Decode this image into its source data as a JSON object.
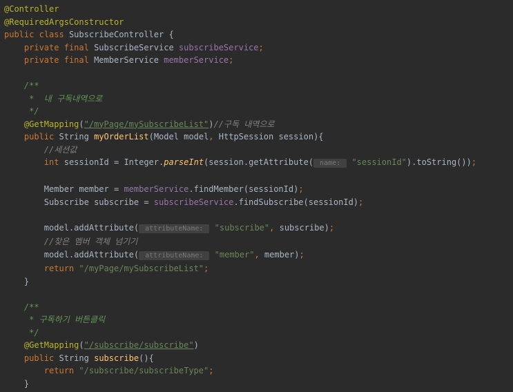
{
  "code": {
    "l1": {
      "anno": "@Controller"
    },
    "l2": {
      "anno": "@RequiredArgsConstructor"
    },
    "l3": {
      "kw1": "public",
      "kw2": "class",
      "cls": "SubscribeController",
      "brace": "{"
    },
    "l4": {
      "indent": "    ",
      "kw1": "private",
      "kw2": "final",
      "type": "SubscribeService",
      "field": "subscribeService",
      "semi": ";"
    },
    "l5": {
      "indent": "    ",
      "kw1": "private",
      "kw2": "final",
      "type": "MemberService",
      "field": "memberService",
      "semi": ";"
    },
    "l7": {
      "indent": "    ",
      "doc": "/**"
    },
    "l8": {
      "indent": "     ",
      "doc": "*  내 구독내역으로"
    },
    "l9": {
      "indent": "     ",
      "doc": "*/"
    },
    "l10": {
      "indent": "    ",
      "anno": "@GetMapping",
      "p1": "(",
      "str": "\"/myPage/mySubscribeList\"",
      "p2": ")",
      "cmt": "//구독 내역으로"
    },
    "l11": {
      "indent": "    ",
      "kw": "public",
      "type": "String",
      "method": "myOrderList",
      "p1": "(",
      "ptype1": "Model",
      "pname1": "model",
      "comma": ",",
      "ptype2": "HttpSession",
      "pname2": "session",
      "p2": ")",
      "brace": "{"
    },
    "l12": {
      "indent": "        ",
      "cmt": "//세션값"
    },
    "l13": {
      "indent": "        ",
      "kw": "int",
      "var": "sessionId",
      "eq": " = ",
      "cls": "Integer",
      "dot": ".",
      "m1": "parseInt",
      "p1": "(",
      "o1": "session",
      "d1": ".",
      "m2": "getAttribute",
      "p2": "(",
      "hint": " name: ",
      "str1": "\"sessionId\"",
      "p3": ")",
      "d2": ".",
      "m3": "toString",
      "p4": "())",
      "semi": ";"
    },
    "l15": {
      "indent": "        ",
      "type": "Member",
      "var": "member",
      "eq": " = ",
      "fld": "memberService",
      "dot": ".",
      "m": "findMember",
      "p1": "(",
      "arg": "sessionId",
      "p2": ")",
      "semi": ";"
    },
    "l16": {
      "indent": "        ",
      "type": "Subscribe",
      "var": "subscribe",
      "eq": " = ",
      "fld": "subscribeService",
      "dot": ".",
      "m": "findSubscribe",
      "p1": "(",
      "arg": "sessionId",
      "p2": ")",
      "semi": ";"
    },
    "l18": {
      "indent": "        ",
      "var": "model",
      "dot": ".",
      "m": "addAttribute",
      "p1": "(",
      "hint": " attributeName: ",
      "str": "\"subscribe\"",
      "comma": ",",
      "arg": "subscribe",
      "p2": ")",
      "semi": ";"
    },
    "l19": {
      "indent": "        ",
      "cmt": "//찾은 멤버 객체 넘기기"
    },
    "l20": {
      "indent": "        ",
      "var": "model",
      "dot": ".",
      "m": "addAttribute",
      "p1": "(",
      "hint": " attributeName: ",
      "str": "\"member\"",
      "comma": ",",
      "arg": "member",
      "p2": ")",
      "semi": ";"
    },
    "l21": {
      "indent": "        ",
      "kw": "return",
      "str": "\"/myPage/mySubscribeList\"",
      "semi": ";"
    },
    "l22": {
      "indent": "    ",
      "brace": "}"
    },
    "l24": {
      "indent": "    ",
      "doc": "/**"
    },
    "l25": {
      "indent": "     ",
      "doc": "* 구독하기 버튼클릭"
    },
    "l26": {
      "indent": "     ",
      "doc": "*/"
    },
    "l27": {
      "indent": "    ",
      "anno": "@GetMapping",
      "p1": "(",
      "str": "\"/subscribe/subscribe\"",
      "p2": ")"
    },
    "l28": {
      "indent": "    ",
      "kw": "public",
      "type": "String",
      "method": "subscribe",
      "p1": "()",
      "brace": "{"
    },
    "l29": {
      "indent": "        ",
      "kw": "return",
      "str": "\"/subscribe/subscribeType\"",
      "semi": ";"
    },
    "l30": {
      "indent": "    ",
      "brace": "}"
    }
  }
}
